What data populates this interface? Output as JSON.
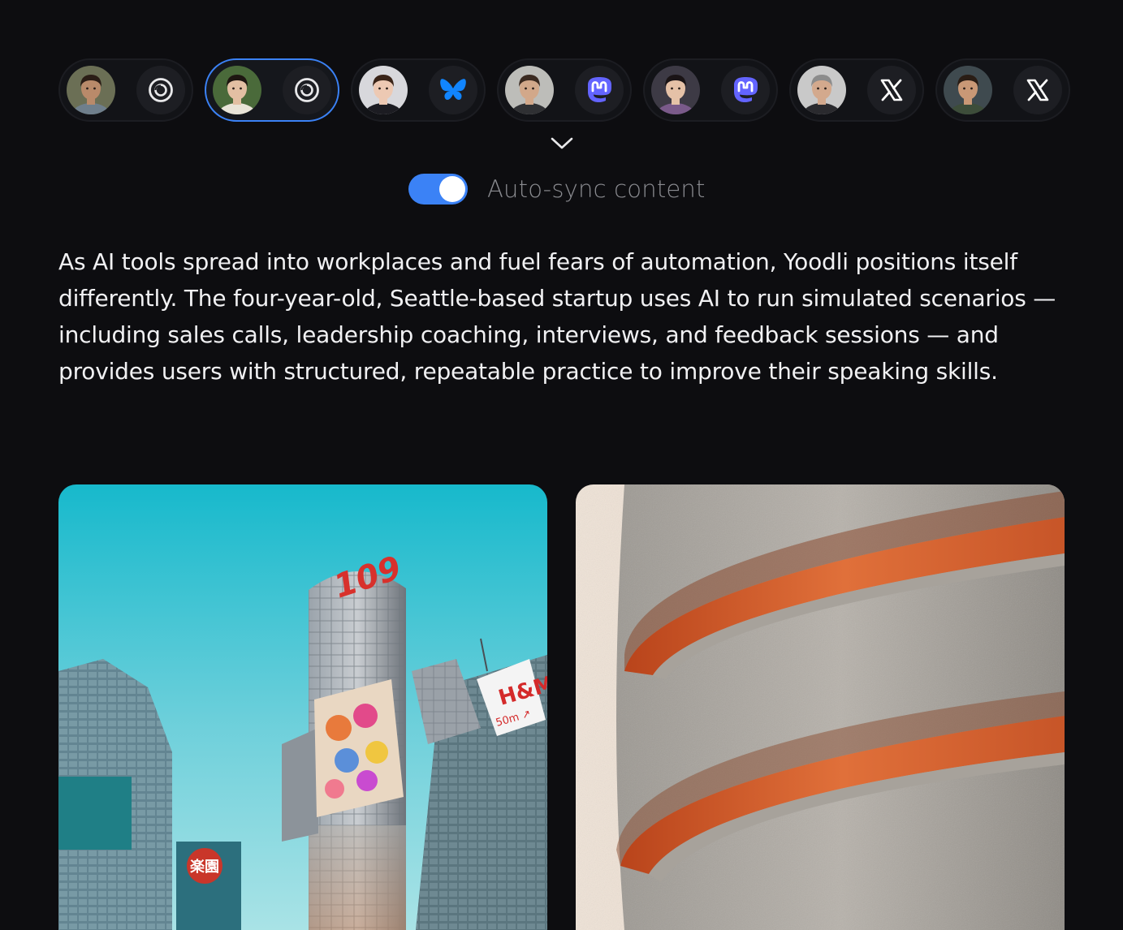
{
  "accounts": [
    {
      "network": "threads",
      "network_icon": "threads-icon",
      "avatar_skin": "#b98a6a",
      "avatar_hair": "#2b1d16",
      "avatar_bg": "#6b6f55",
      "avatar_shirt": "#6f7f8c",
      "selected": false
    },
    {
      "network": "threads",
      "network_icon": "threads-icon",
      "avatar_skin": "#e2bfa3",
      "avatar_hair": "#1e1611",
      "avatar_bg": "#4a6a3a",
      "avatar_shirt": "#e9e4d8",
      "selected": true
    },
    {
      "network": "bluesky",
      "network_icon": "bluesky-butterfly-icon",
      "avatar_skin": "#edc9b3",
      "avatar_hair": "#3a2418",
      "avatar_bg": "#d8d8dc",
      "avatar_shirt": "#1c1c22",
      "selected": false
    },
    {
      "network": "mastodon",
      "network_icon": "mastodon-icon",
      "avatar_skin": "#d2a88a",
      "avatar_hair": "#3b2a20",
      "avatar_bg": "#bdbdb9",
      "avatar_shirt": "#2f3033",
      "selected": false
    },
    {
      "network": "mastodon",
      "network_icon": "mastodon-icon",
      "avatar_skin": "#e5c1a7",
      "avatar_hair": "#1a1416",
      "avatar_bg": "#3d3a45",
      "avatar_shirt": "#7a5a8a",
      "selected": false
    },
    {
      "network": "x",
      "network_icon": "x-logo-icon",
      "avatar_skin": "#d3a98d",
      "avatar_hair": "#8c8c8c",
      "avatar_bg": "#c9c9c9",
      "avatar_shirt": "#2a2a2e",
      "selected": false
    },
    {
      "network": "x",
      "network_icon": "x-logo-icon",
      "avatar_skin": "#c99876",
      "avatar_hair": "#2a1d15",
      "avatar_bg": "#3f4a4f",
      "avatar_shirt": "#3d4d3a",
      "selected": false
    }
  ],
  "expand_icon": "chevron-down-icon",
  "sync": {
    "label": "Auto-sync content",
    "enabled": true
  },
  "post": {
    "body": "As AI tools spread into workplaces and fuel fears of automation, Yoodli positions itself differently. The four-year-old, Seattle-based startup uses AI to run simulated scenarios — including sales calls, leadership coaching, interviews, and feedback sessions — and provides users with structured, repeatable practice to improve their speaking skills."
  },
  "media": [
    {
      "name": "city-tower-photo",
      "sign_main": "109",
      "sign_store": "H&M",
      "sign_store_sub": "50m ↗",
      "sign_left": "楽園"
    },
    {
      "name": "spiral-architecture-photo"
    }
  ],
  "colors": {
    "background": "#0d0d10",
    "accent": "#3b82f6",
    "mastodon": "#6364ff",
    "bluesky": "#1185fe",
    "text": "#f1f1f3",
    "muted": "#8a8b90"
  }
}
